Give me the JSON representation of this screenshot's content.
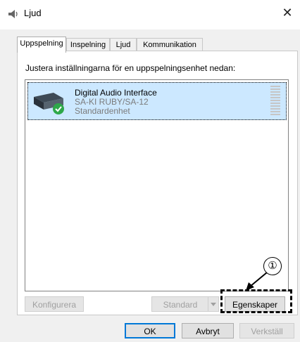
{
  "window": {
    "title": "Ljud",
    "close_glyph": "✕"
  },
  "tabs": [
    {
      "label": "Uppspelning",
      "active": true
    },
    {
      "label": "Inspelning",
      "active": false
    },
    {
      "label": "Ljud",
      "active": false
    },
    {
      "label": "Kommunikation",
      "active": false
    }
  ],
  "panel": {
    "instruction": "Justera inställningarna för en uppspelningsenhet nedan:",
    "devices": [
      {
        "name": "Digital Audio Interface",
        "model": "SA-KI RUBY/SA-12",
        "status": "Standardenhet",
        "selected": true,
        "icon": "speaker-device-icon",
        "badge": "check-icon"
      }
    ],
    "buttons": {
      "configure": "Konfigurera",
      "set_default": "Standard",
      "properties": "Egenskaper"
    }
  },
  "dialog_buttons": {
    "ok": "OK",
    "cancel": "Avbryt",
    "apply": "Verkställ"
  },
  "annotation": {
    "callout_label": "①"
  },
  "colors": {
    "selection": "#cce8ff",
    "accent": "#0078d7",
    "check": "#2ea84a"
  }
}
